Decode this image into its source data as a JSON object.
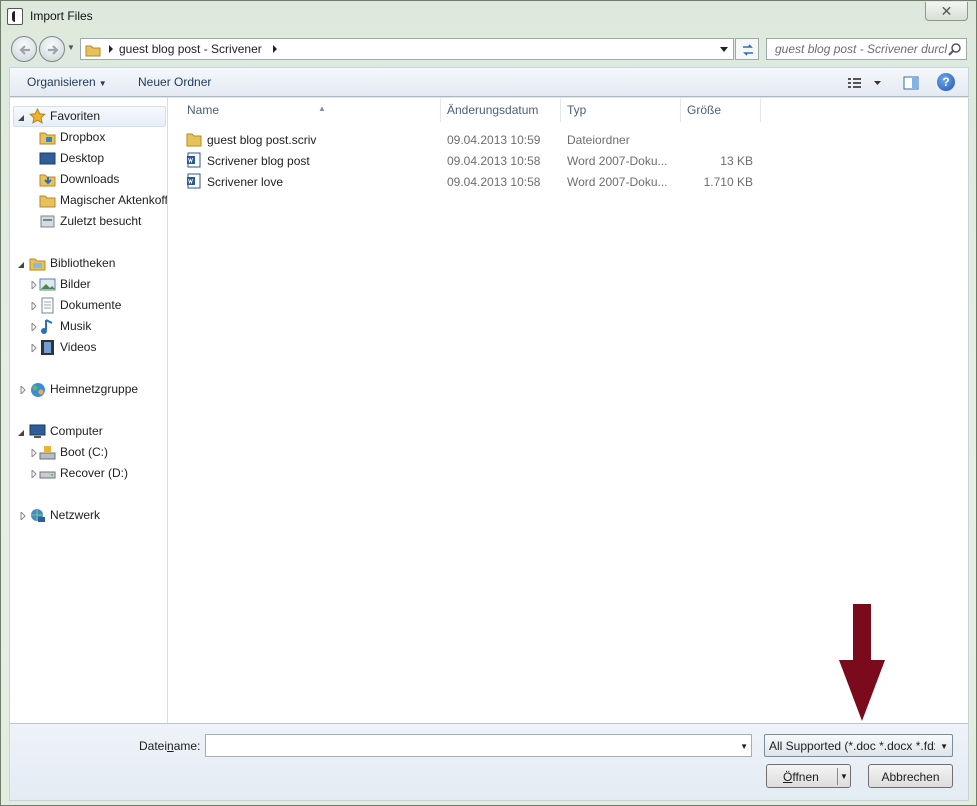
{
  "window": {
    "title": "Import Files",
    "close_label": "✕"
  },
  "address": {
    "crumb": "guest blog post - Scrivener"
  },
  "search": {
    "placeholder": "guest blog post - Scrivener durchsuchen"
  },
  "toolbar": {
    "organize_label": "Organisieren",
    "new_folder_label": "Neuer Ordner"
  },
  "nav": {
    "favorites": {
      "label": "Favoriten",
      "items": [
        "Dropbox",
        "Desktop",
        "Downloads",
        "Magischer Aktenkoffer",
        "Zuletzt besucht"
      ]
    },
    "libraries": {
      "label": "Bibliotheken",
      "items": [
        "Bilder",
        "Dokumente",
        "Musik",
        "Videos"
      ]
    },
    "homegroup": {
      "label": "Heimnetzgruppe"
    },
    "computer": {
      "label": "Computer",
      "items": [
        "Boot (C:)",
        "Recover (D:)"
      ]
    },
    "network": {
      "label": "Netzwerk"
    }
  },
  "columns": {
    "name": "Name",
    "date": "Änderungsdatum",
    "type": "Typ",
    "size": "Größe"
  },
  "files": [
    {
      "name": "guest blog post.scriv",
      "date": "09.04.2013 10:59",
      "type": "Dateiordner",
      "size": "",
      "icon": "folder-icon"
    },
    {
      "name": "Scrivener blog post",
      "date": "09.04.2013 10:58",
      "type": "Word 2007-Doku...",
      "size": "13 KB",
      "icon": "word-document-icon"
    },
    {
      "name": "Scrivener love",
      "date": "09.04.2013 10:58",
      "type": "Word 2007-Doku...",
      "size": "1.710 KB",
      "icon": "word-document-icon"
    }
  ],
  "bottom": {
    "filename_label_pre": "Datei",
    "filename_label_u": "n",
    "filename_label_post": "ame:",
    "filename_value": "",
    "filter_label": "All Supported (*.doc *.docx *.fdx",
    "open_label_pre": "",
    "open_label_u": "Ö",
    "open_label_post": "ffnen",
    "cancel_label": "Abbrechen"
  },
  "colors": {
    "annotation_arrow": "#7a0a1c",
    "toolbar_text": "#1e395b"
  }
}
